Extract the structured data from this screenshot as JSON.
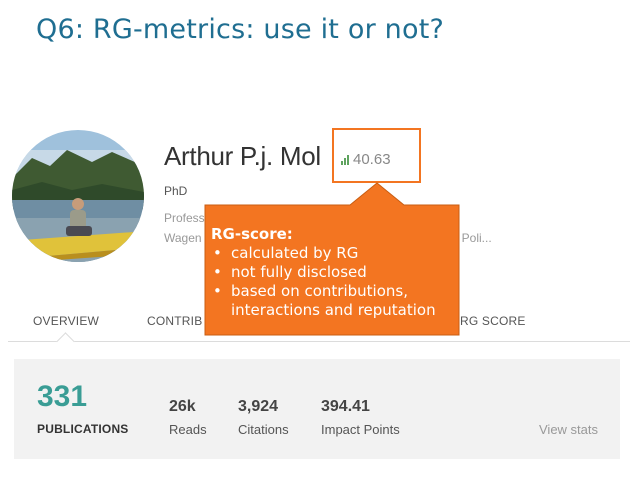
{
  "slide": {
    "title": "Q6: RG-metrics: use it or not?"
  },
  "profile": {
    "name": "Arthur P.j. Mol",
    "score": "40.63",
    "degree": "PhD",
    "position_partial": "Profess",
    "institution_partial": "Wagen",
    "institution_tail": "al Poli..."
  },
  "tabs": [
    "OVERVIEW",
    "CONTRIB",
    "RG SCORE"
  ],
  "stats": {
    "publications": {
      "value": "331",
      "label": "PUBLICATIONS"
    },
    "reads": {
      "value": "26k",
      "label": "Reads"
    },
    "citations": {
      "value": "3,924",
      "label": "Citations"
    },
    "impact": {
      "value": "394.41",
      "label": "Impact Points"
    },
    "view_stats": "View stats"
  },
  "callout": {
    "title": "RG-score:",
    "items": [
      "calculated by RG",
      "not fully disclosed",
      "based on contributions, interactions and reputation"
    ]
  },
  "colors": {
    "accent": "#f37521",
    "title": "#1f6e91",
    "publications": "#3a9d95"
  },
  "icons": [
    "bar-chart-icon"
  ]
}
